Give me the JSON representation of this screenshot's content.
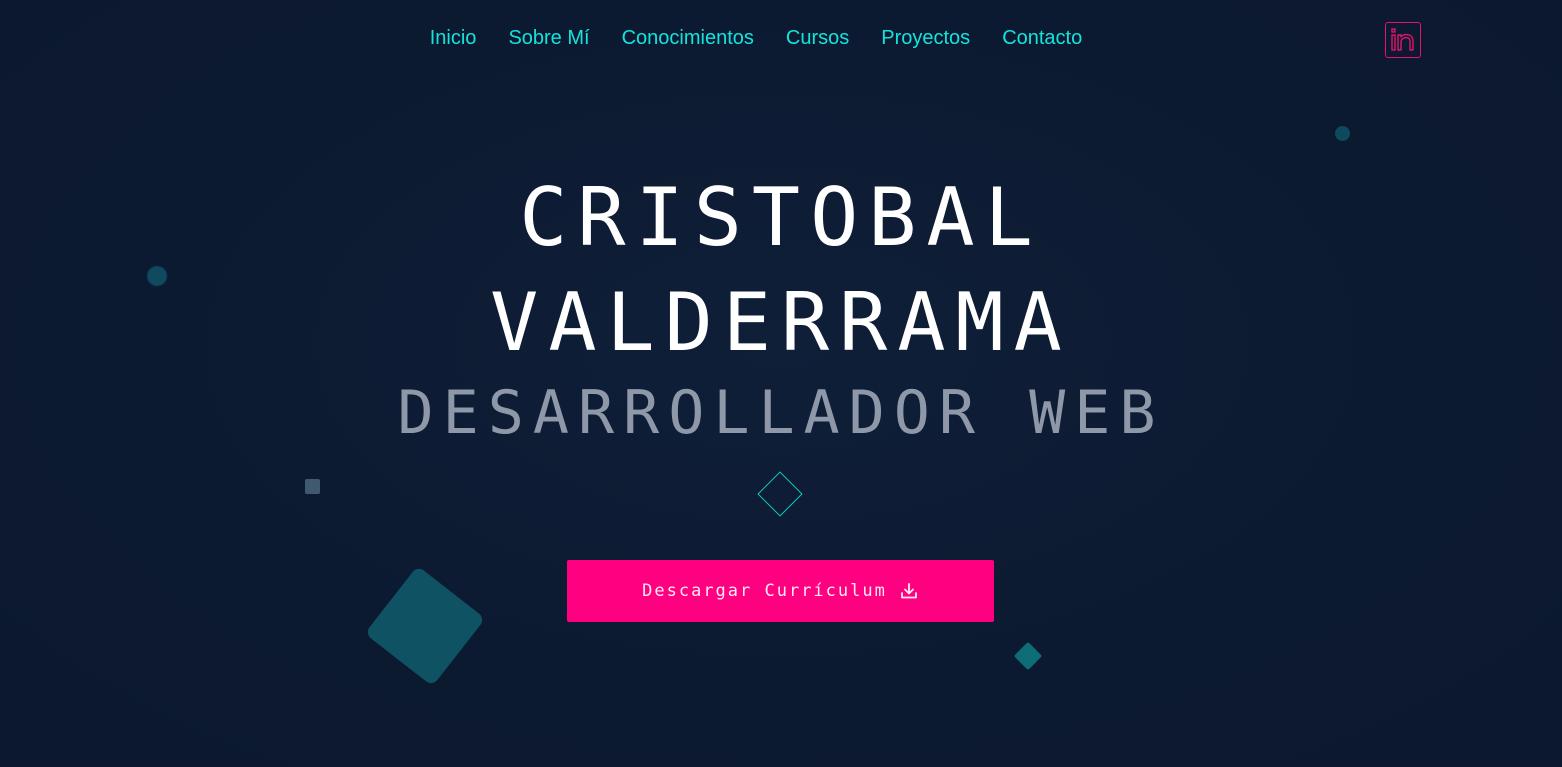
{
  "nav": {
    "items": [
      {
        "label": "Inicio"
      },
      {
        "label": "Sobre Mí"
      },
      {
        "label": "Conocimientos"
      },
      {
        "label": "Cursos"
      },
      {
        "label": "Proyectos"
      },
      {
        "label": "Contacto"
      }
    ],
    "social_icon": "linkedin-icon"
  },
  "hero": {
    "first_name": "CRISTOBAL",
    "last_name": "VALDERRAMA",
    "role": "DESARROLLADOR WEB",
    "cta_label": "Descargar Currículum",
    "cta_icon": "download-icon"
  },
  "colors": {
    "background": "#0c1a31",
    "accent_cyan": "#14e3dc",
    "accent_pink": "#ff0080",
    "role_gray": "#8e98a8"
  }
}
